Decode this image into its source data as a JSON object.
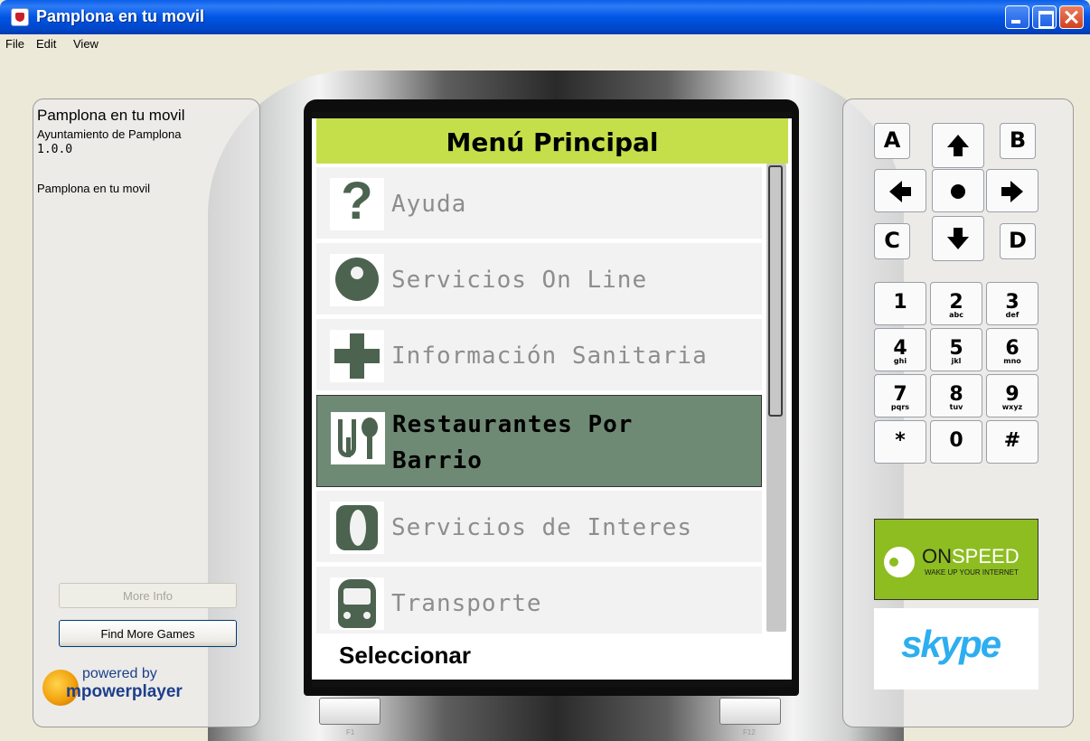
{
  "window": {
    "title": "Pamplona en tu movil",
    "menu": [
      "File",
      "Edit",
      "View"
    ]
  },
  "info_panel": {
    "app_name": "Pamplona en tu movil",
    "vendor": "Ayuntamiento de Pamplona",
    "version": "1.0.0",
    "description": "Pamplona en tu movil",
    "more_info_label": "More Info",
    "find_more_label": "Find More Games",
    "logo_powered": "powered by",
    "logo_brand": "mpowerplayer"
  },
  "phone_screen": {
    "header_title": "Menú Principal",
    "items": [
      {
        "label": "Ayuda",
        "icon": "question-icon",
        "selected": false
      },
      {
        "label": "Servicios On Line",
        "icon": "online-services-icon",
        "selected": false
      },
      {
        "label": "Información Sanitaria",
        "icon": "health-cross-icon",
        "selected": false
      },
      {
        "label": "Restaurantes Por",
        "label2": "Barrio",
        "icon": "fork-spoon-icon",
        "selected": true
      },
      {
        "label": "Servicios de Interes",
        "icon": "info-icon",
        "selected": false
      },
      {
        "label": "Transporte",
        "icon": "bus-icon",
        "selected": false
      }
    ],
    "softkey_left": "Seleccionar",
    "colors": {
      "header": "#c4df4a",
      "selected_row": "#6f8a74",
      "icon": "#4c6350"
    }
  },
  "hardware_keys": {
    "f1": "F1",
    "f12": "F12"
  },
  "keypad": {
    "letter_keys": [
      "A",
      "B",
      "C",
      "D"
    ],
    "arrow_icons": [
      "arrow-up-icon",
      "arrow-left-icon",
      "select-dot-icon",
      "arrow-right-icon",
      "arrow-down-icon"
    ],
    "number_keys": [
      {
        "main": "1",
        "sub": ""
      },
      {
        "main": "2",
        "sub": "abc"
      },
      {
        "main": "3",
        "sub": "def"
      },
      {
        "main": "4",
        "sub": "ghi"
      },
      {
        "main": "5",
        "sub": "jkl"
      },
      {
        "main": "6",
        "sub": "mno"
      },
      {
        "main": "7",
        "sub": "pqrs"
      },
      {
        "main": "8",
        "sub": "tuv"
      },
      {
        "main": "9",
        "sub": "wxyz"
      },
      {
        "main": "*",
        "sub": ""
      },
      {
        "main": "0",
        "sub": ""
      },
      {
        "main": "#",
        "sub": ""
      }
    ]
  },
  "ads": {
    "onspeed_on": "ON",
    "onspeed_speed": "SPEED",
    "onspeed_tagline": "WAKE UP YOUR INTERNET",
    "skype": "skype"
  }
}
